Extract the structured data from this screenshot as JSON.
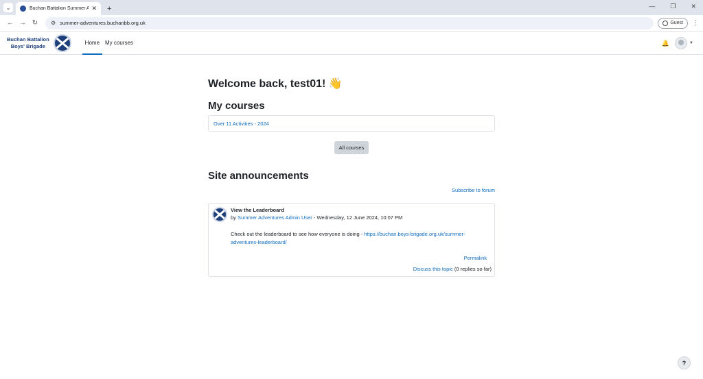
{
  "browser": {
    "tab_title": "Buchan Battalion Summer Adve",
    "url": "summer-adventures.buchanbb.org.uk",
    "guest_label": "Guest"
  },
  "site": {
    "brand_line1": "Buchan Battalion",
    "brand_line2": "Boys' Brigade",
    "nav": [
      {
        "label": "Home",
        "active": true
      },
      {
        "label": "My courses",
        "active": false
      }
    ]
  },
  "main": {
    "welcome": "Welcome back, test01! 👋",
    "my_courses_title": "My courses",
    "course": "Over 11 Activities - 2024",
    "all_courses": "All courses",
    "announcements_title": "Site announcements",
    "subscribe": "Subscribe to forum",
    "post": {
      "subject": "View the Leaderboard",
      "by": "by",
      "author": "Summer Adventures Admin User",
      "date": "- Wednesday, 12 June 2024, 10:07 PM",
      "body": "Check out the leaderboard to see how everyone is doing  - ",
      "link": "https://buchan.boys-brigade.org.uk/summer-adventures-leaderboard/",
      "permalink": "Permalink",
      "discuss": "Discuss this topic",
      "replies": "(0 replies so far)"
    }
  },
  "help": "?"
}
